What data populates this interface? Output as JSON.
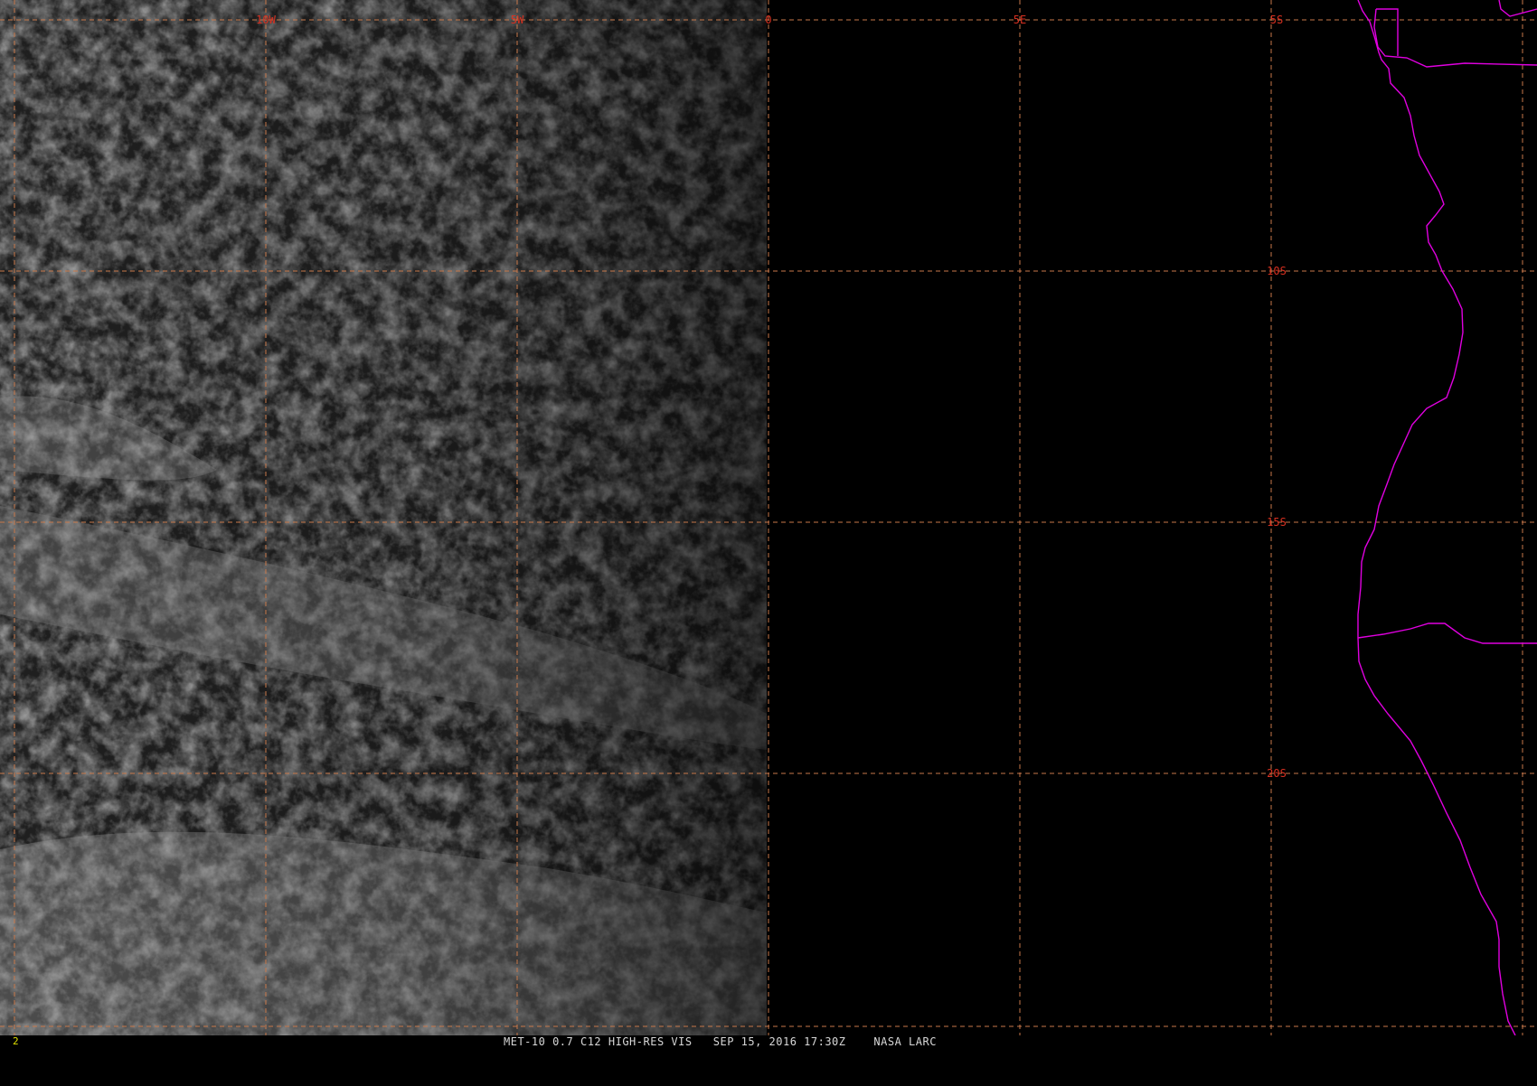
{
  "map": {
    "longitude_labels": [
      "10W",
      "5W",
      "0",
      "5E"
    ],
    "latitude_labels": [
      "5S",
      "10S",
      "15S",
      "20S"
    ],
    "colors": {
      "background": "#000000",
      "gridline": "#c8784a",
      "grid_label": "#d83020",
      "coastline": "#e000e0",
      "frame_number": "#e0e000"
    }
  },
  "status_bar": {
    "frame_number": "2",
    "caption": "MET-10 0.7 C12 HIGH-RES VIS   SEP 15, 2016 17:30Z    NASA LARC"
  }
}
